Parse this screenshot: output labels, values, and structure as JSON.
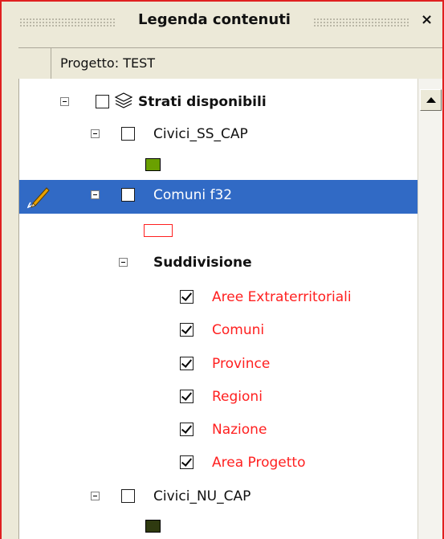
{
  "panel": {
    "title": "Legenda contenuti",
    "close_glyph": "×",
    "project_label": "Progetto: TEST"
  },
  "tree": {
    "root_label": "Strati disponibili",
    "layer1_label": "Civici_SS_CAP",
    "layer1_swatch_color": "#6aa000",
    "layer2_label": "Comuni f32",
    "layer2_swatch_outline_color": "#ff2020",
    "group_label": "Suddivisione",
    "subitems": [
      "Aree Extraterritoriali",
      "Comuni",
      "Province",
      "Regioni",
      "Nazione",
      "Area Progetto"
    ],
    "layer3_label": "Civici_NU_CAP",
    "layer3_swatch_color": "#2f3a10"
  },
  "colors": {
    "selection": "#316ac5",
    "accent_red": "#ff2020"
  },
  "icons": [
    "layers-icon",
    "pencil-icon",
    "expander-icon",
    "checkbox-icon",
    "scroll-up-icon",
    "close-icon"
  ]
}
